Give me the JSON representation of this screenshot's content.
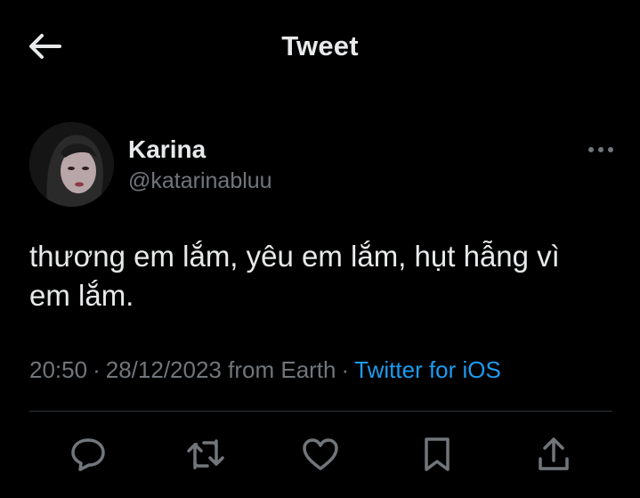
{
  "header": {
    "title": "Tweet",
    "back_icon": "arrow-left-icon"
  },
  "author": {
    "name": "Karina",
    "handle": "@katarinabluu",
    "avatar": "avatar-photo"
  },
  "tweet": {
    "text_line1": "thương em lắm, yêu em lắm, hụt hẫng vì",
    "text_line2": "em lắm."
  },
  "meta": {
    "time": "20:50",
    "separator1": "·",
    "date": "28/12/2023",
    "location": "from Earth",
    "separator2": "·",
    "source": "Twitter for iOS"
  },
  "actions": [
    {
      "name": "reply",
      "icon": "reply-icon"
    },
    {
      "name": "retweet",
      "icon": "retweet-icon"
    },
    {
      "name": "like",
      "icon": "heart-icon"
    },
    {
      "name": "bookmark",
      "icon": "bookmark-icon"
    },
    {
      "name": "share",
      "icon": "share-icon"
    }
  ],
  "colors": {
    "background": "#000000",
    "primary_text": "#e7e9ea",
    "secondary_text": "#71767b",
    "link": "#1d9bf0",
    "divider": "#2f3336"
  }
}
